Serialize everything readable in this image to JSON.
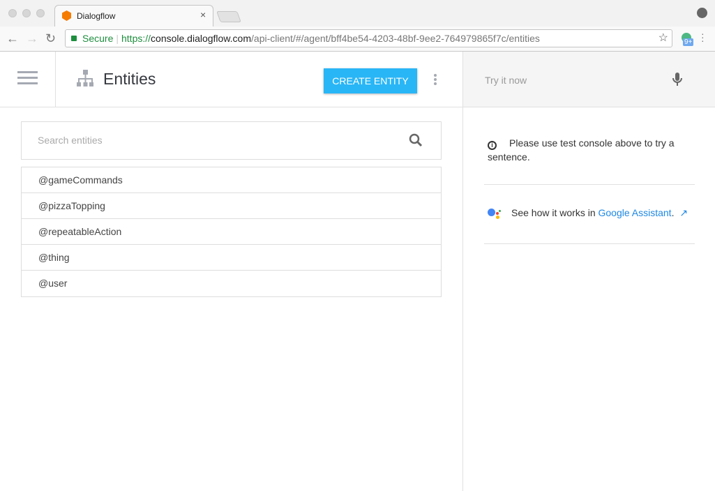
{
  "browser": {
    "tab_title": "Dialogflow",
    "tab_close": "×",
    "secure_label": "Secure",
    "url_scheme": "https://",
    "url_host": "console.dialogflow.com",
    "url_path": "/api-client/#/agent/bff4be54-4203-48bf-9ee2-764979865f7c/entities",
    "extension_badge": "9+",
    "star": "☆"
  },
  "header": {
    "title": "Entities",
    "create_button": "CREATE ENTITY"
  },
  "search": {
    "placeholder": "Search entities"
  },
  "entities": [
    "@gameCommands",
    "@pizzaTopping",
    "@repeatableAction",
    "@thing",
    "@user"
  ],
  "right": {
    "try_placeholder": "Try it now",
    "info_text": "Please use test console above to try a sentence.",
    "ga_prefix": "See how it works in ",
    "ga_link": "Google Assistant",
    "ga_suffix": "."
  },
  "colors": {
    "accent": "#29b6f6",
    "link": "#1e88e5"
  }
}
